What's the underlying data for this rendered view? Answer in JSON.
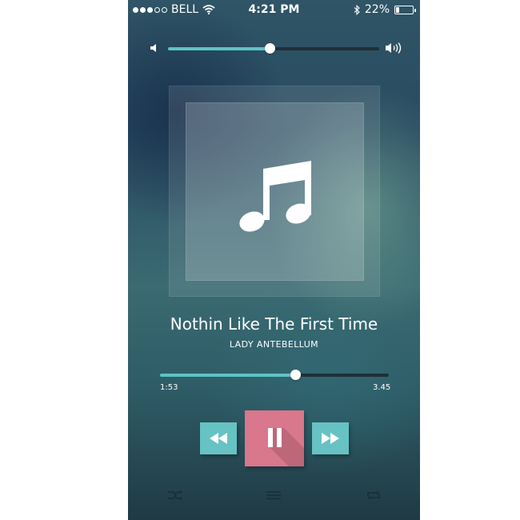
{
  "status_bar": {
    "signal_full": 3,
    "signal_empty": 2,
    "carrier": "BELL",
    "time": "4:21 PM",
    "battery_text": "22%",
    "battery_level": 0.22
  },
  "volume": {
    "level": 0.48,
    "low_icon": "speaker-low-icon",
    "high_icon": "speaker-high-icon"
  },
  "artwork": {
    "icon": "music-note-icon"
  },
  "track": {
    "title": "Nothin Like The First Time",
    "artist": "LADY ANTEBELLUM"
  },
  "progress": {
    "fraction": 0.59,
    "elapsed": "1:53",
    "total": "3.45"
  },
  "controls": {
    "rewind_icon": "rewind-icon",
    "pause_icon": "pause-icon",
    "forward_icon": "fast-forward-icon"
  },
  "bottom_bar": {
    "shuffle_icon": "shuffle-icon",
    "menu_icon": "list-icon",
    "repeat_icon": "repeat-icon"
  },
  "colors": {
    "accent": "#5fc3c4",
    "button_teal": "#67c2c3",
    "button_pink": "#d9778c",
    "track_bg": "#1e3038"
  }
}
